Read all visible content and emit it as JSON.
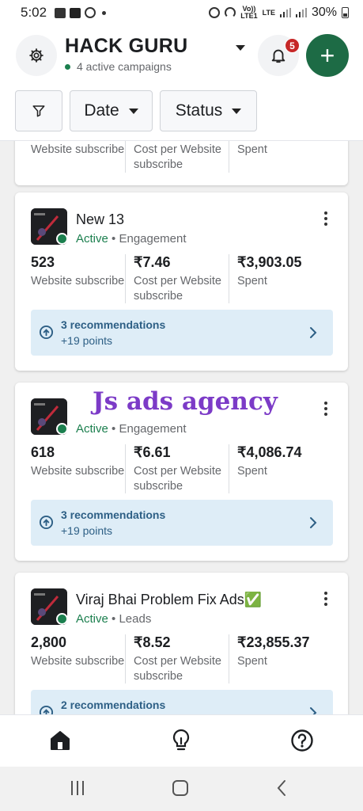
{
  "status_bar": {
    "time": "5:02",
    "carrier_badge_top": "Vo))",
    "carrier_badge_bottom": "LTE1",
    "network": "LTE",
    "battery": "30%"
  },
  "header": {
    "title": "HACK GURU",
    "subtitle": "4 active campaigns",
    "notification_count": "5",
    "add_label": "+"
  },
  "filters": {
    "date_label": "Date",
    "status_label": "Status"
  },
  "campaigns": [
    {
      "name": "",
      "status": "",
      "objective": "",
      "results": "",
      "results_label": "Website subscribe",
      "cost": "",
      "cost_label_line1": "Cost per Website",
      "cost_label_line2": "subscribe",
      "spent": "",
      "spent_label": "Spent"
    },
    {
      "name": "New 13",
      "status": "Active",
      "objective": "Engagement",
      "results": "523",
      "results_label": "Website subscribe",
      "cost": "₹7.46",
      "cost_label_line1": "Cost per Website",
      "cost_label_line2": "subscribe",
      "spent": "₹3,903.05",
      "spent_label": "Spent",
      "recommendations": "3 recommendations",
      "points": "+19 points"
    },
    {
      "name": "",
      "status": "Active",
      "objective": "Engagement",
      "results": "618",
      "results_label": "Website subscribe",
      "cost": "₹6.61",
      "cost_label_line1": "Cost per Website",
      "cost_label_line2": "subscribe",
      "spent": "₹4,086.74",
      "spent_label": "Spent",
      "recommendations": "3 recommendations",
      "points": "+19 points",
      "watermark": "Js ads agency"
    },
    {
      "name": "Viraj Bhai Problem Fix Ads✅",
      "status": "Active",
      "objective": "Leads",
      "results": "2,800",
      "results_label": "Website subscribe",
      "cost": "₹8.52",
      "cost_label_line1": "Cost per Website",
      "cost_label_line2": "subscribe",
      "spent": "₹23,855.37",
      "spent_label": "Spent",
      "recommendations": "2 recommendations"
    }
  ],
  "bottom_nav": {
    "items": [
      "home-icon",
      "lightbulb-icon",
      "help-icon"
    ]
  },
  "colors": {
    "accent_green": "#1d6b45",
    "active_green": "#1b7f4e",
    "rec_bg": "#deedf7",
    "rec_text": "#2d5f85",
    "badge_red": "#c62828",
    "watermark_purple": "#7c3bc7"
  }
}
